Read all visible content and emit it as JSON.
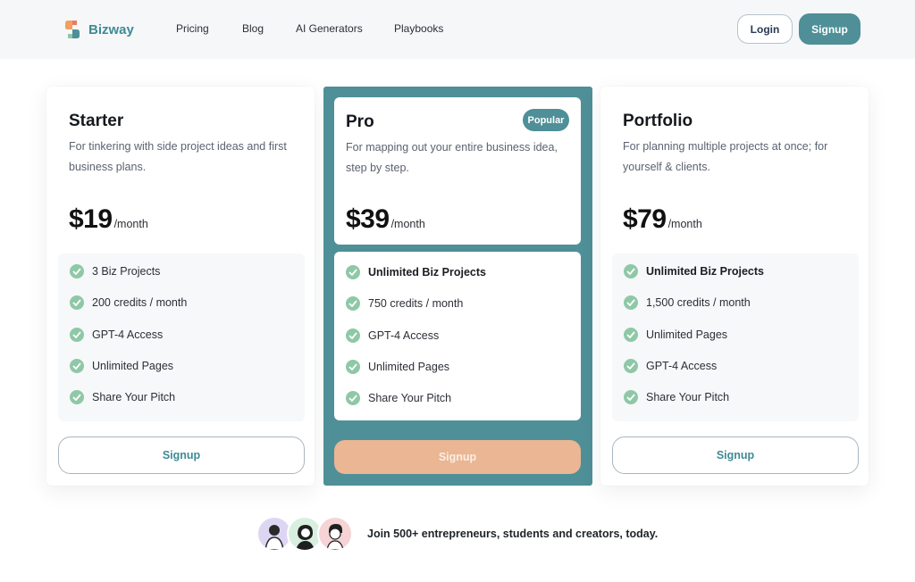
{
  "brand": {
    "name": "Bizway"
  },
  "nav": [
    {
      "label": "Pricing"
    },
    {
      "label": "Blog"
    },
    {
      "label": "AI Generators"
    },
    {
      "label": "Playbooks"
    }
  ],
  "header": {
    "login_label": "Login",
    "signup_label": "Signup"
  },
  "plans": [
    {
      "name": "Starter",
      "description": "For tinkering with side project ideas and first business plans.",
      "price": "$19",
      "period": "/month",
      "features": [
        {
          "label": "3 Biz Projects"
        },
        {
          "label": "200 credits / month"
        },
        {
          "label": "GPT-4 Access"
        },
        {
          "label": "Unlimited Pages"
        },
        {
          "label": "Share Your Pitch"
        }
      ],
      "cta": "Signup"
    },
    {
      "name": "Pro",
      "badge": "Popular",
      "description": "For mapping out your entire business idea, step by step.",
      "price": "$39",
      "period": "/month",
      "features": [
        {
          "label": "Unlimited Biz Projects"
        },
        {
          "label": "750 credits / month"
        },
        {
          "label": "GPT-4 Access"
        },
        {
          "label": "Unlimited Pages"
        },
        {
          "label": "Share Your Pitch"
        }
      ],
      "cta": "Signup"
    },
    {
      "name": "Portfolio",
      "description": "For planning multiple projects at once; for yourself & clients.",
      "price": "$79",
      "period": "/month",
      "features": [
        {
          "label": "Unlimited Biz Projects"
        },
        {
          "label": "1,500 credits / month"
        },
        {
          "label": "Unlimited Pages"
        },
        {
          "label": "GPT-4 Access"
        },
        {
          "label": "Share Your Pitch"
        }
      ],
      "cta": "Signup"
    }
  ],
  "social_proof": {
    "text": "Join 500+ entrepreneurs, students and creators, today."
  },
  "colors": {
    "accent": "#4f8f98",
    "check": "#8fc8a6",
    "pro_cta": "#eab693",
    "avatar_backgrounds": [
      "#ddd6f3",
      "#d8efe0",
      "#f6d3d5"
    ]
  }
}
